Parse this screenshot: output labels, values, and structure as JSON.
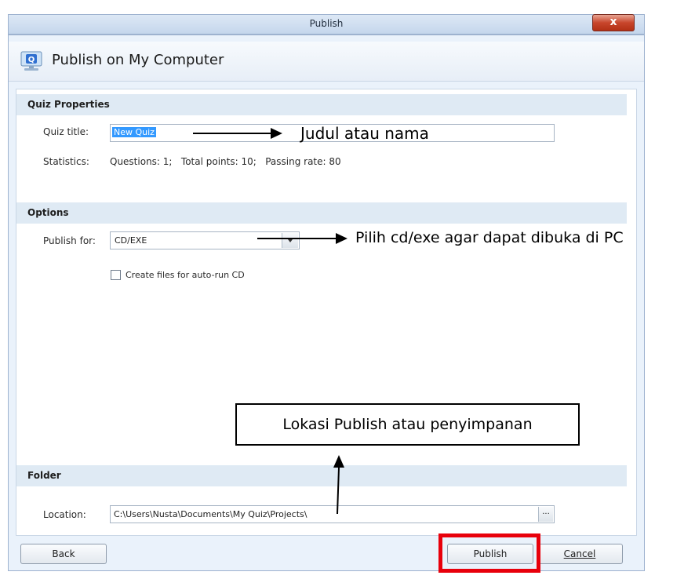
{
  "window": {
    "title": "Publish",
    "close_label": "x"
  },
  "header": {
    "title": "Publish on My Computer",
    "icon": "publish-computer-icon"
  },
  "quiz_properties": {
    "section_label": "Quiz Properties",
    "title_label": "Quiz title:",
    "title_value": "New Quiz",
    "statistics_label": "Statistics:",
    "statistics_value": "Questions: 1;   Total points: 10;   Passing rate: 80"
  },
  "options": {
    "section_label": "Options",
    "publish_for_label": "Publish for:",
    "publish_for_value": "CD/EXE",
    "autorun_label": "Create files for auto-run CD",
    "autorun_checked": false
  },
  "folder": {
    "section_label": "Folder",
    "location_label": "Location:",
    "location_value": "C:\\Users\\Nusta\\Documents\\My Quiz\\Projects\\",
    "browse_label": "..."
  },
  "buttons": {
    "back": "Back",
    "publish": "Publish",
    "cancel": "Cancel"
  },
  "annotations": {
    "title_note": "Judul atau nama",
    "publish_for_note": "Pilih cd/exe agar dapat dibuka di PC",
    "location_note": "Lokasi Publish atau penyimpanan"
  },
  "colors": {
    "highlight_box": "#e8000b",
    "section_bg": "#dfeaf4",
    "selection": "#3399ff"
  }
}
